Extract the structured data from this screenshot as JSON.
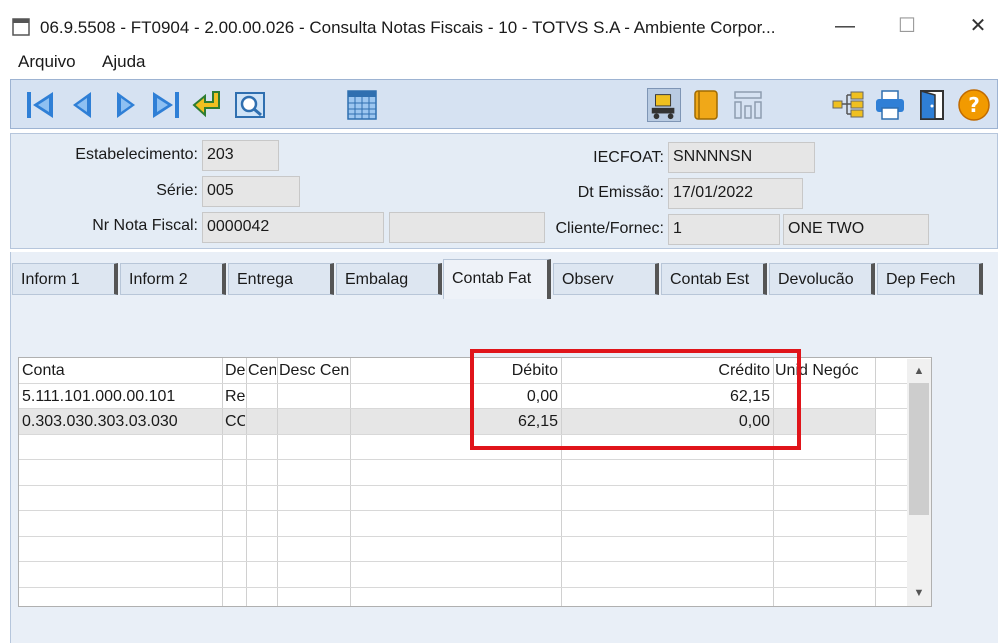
{
  "window": {
    "title": "06.9.5508 - FT0904 - 2.00.00.026 - Consulta Notas Fiscais - 10 - TOTVS S.A - Ambiente Corpor...",
    "minimize": "—",
    "maximize": "☐",
    "close": "✕"
  },
  "menu": {
    "items": [
      "Arquivo",
      "Ajuda"
    ]
  },
  "toolbar": {
    "icons": [
      "first-record-icon",
      "previous-record-icon",
      "next-record-icon",
      "last-record-icon",
      "go-to-icon",
      "search-icon",
      "calendar-icon",
      "loader-icon",
      "book-icon",
      "columns-icon",
      "tree-icon",
      "print-icon",
      "exit-door-icon",
      "help-icon"
    ],
    "help_glyph": "?"
  },
  "header": {
    "estabelecimento_label": "Estabelecimento:",
    "estabelecimento_value": "203",
    "serie_label": "Série:",
    "serie_value": "005",
    "nr_nota_label": "Nr Nota Fiscal:",
    "nr_nota_value": "0000042",
    "nr_nota_extra": "",
    "iecfoat_label": "IECFOAT:",
    "iecfoat_value": "SNNNNSN",
    "dt_emissao_label": "Dt Emissão:",
    "dt_emissao_value": "17/01/2022",
    "cliente_label": "Cliente/Fornec:",
    "cliente_code": "1",
    "cliente_name": "ONE TWO"
  },
  "tabs": [
    "Inform 1",
    "Inform 2",
    "Entrega",
    "Embalag",
    "Contab Fat",
    "Observ",
    "Contab Est",
    "Devolucão",
    "Dep Fech"
  ],
  "active_tab": "Contab Fat",
  "grid": {
    "columns": [
      "Conta",
      "De",
      "Cen",
      "Desc Cen",
      "Débito",
      "Crédito",
      "Unid Negóc"
    ],
    "rows": [
      [
        "5.111.101.000.00.101",
        "Re",
        "",
        "",
        "0,00",
        "62,15",
        ""
      ],
      [
        "0.303.030.303.03.030",
        "CC",
        "",
        "",
        "62,15",
        "0,00",
        ""
      ]
    ],
    "scroll_up": "▲",
    "scroll_down": "▼"
  },
  "colors": {
    "toolbar_bg": "#d6e2f2",
    "panel_bg": "#e4ecf5",
    "highlight": "#e0141a",
    "icon_blue": "#2f7fd6"
  }
}
